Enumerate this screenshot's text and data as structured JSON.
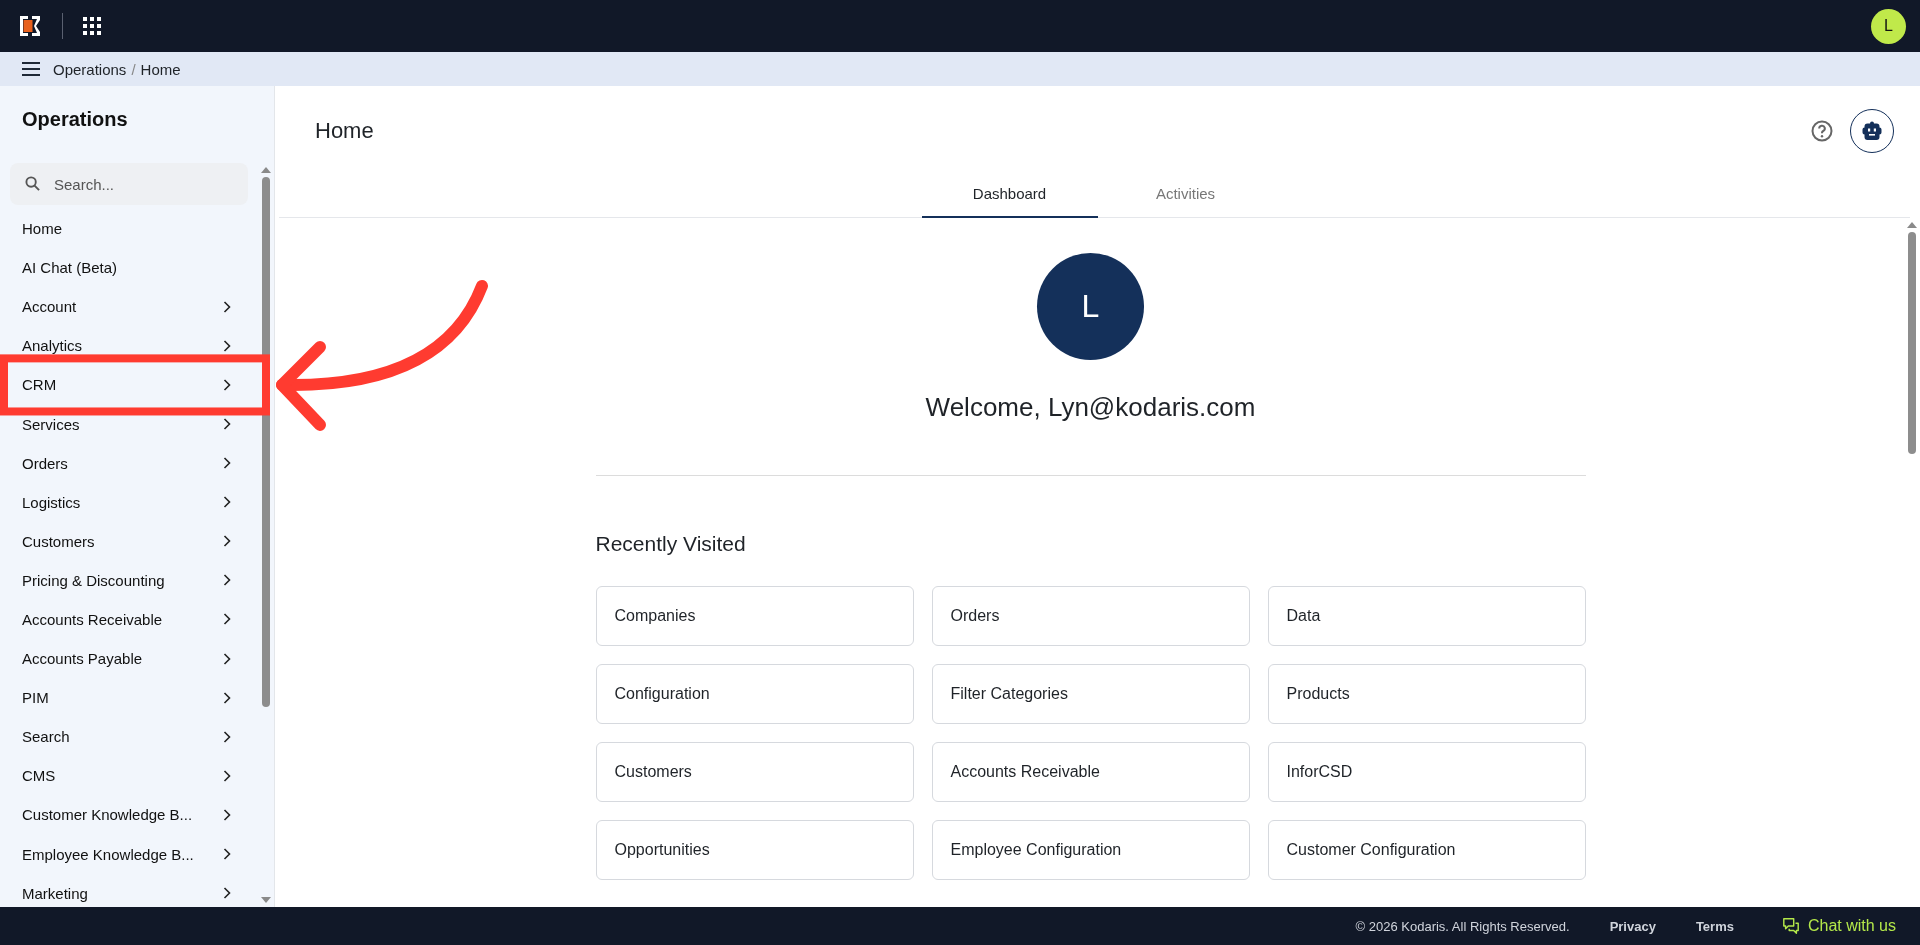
{
  "top_bar": {
    "avatar": "L"
  },
  "breadcrumb": {
    "separator": "/",
    "items": [
      {
        "label": "Operations"
      },
      {
        "label": "Home"
      }
    ]
  },
  "sidebar": {
    "title": "Operations",
    "search": {
      "placeholder": "Search..."
    },
    "items": [
      {
        "label": "Home",
        "has_children": false,
        "highlighted": false
      },
      {
        "label": "AI Chat (Beta)",
        "has_children": false,
        "highlighted": false
      },
      {
        "label": "Account",
        "has_children": true,
        "highlighted": false
      },
      {
        "label": "Analytics",
        "has_children": true,
        "highlighted": false
      },
      {
        "label": "CRM",
        "has_children": true,
        "highlighted": true
      },
      {
        "label": "Services",
        "has_children": true,
        "highlighted": false
      },
      {
        "label": "Orders",
        "has_children": true,
        "highlighted": false
      },
      {
        "label": "Logistics",
        "has_children": true,
        "highlighted": false
      },
      {
        "label": "Customers",
        "has_children": true,
        "highlighted": false
      },
      {
        "label": "Pricing & Discounting",
        "has_children": true,
        "highlighted": false
      },
      {
        "label": "Accounts Receivable",
        "has_children": true,
        "highlighted": false
      },
      {
        "label": "Accounts Payable",
        "has_children": true,
        "highlighted": false
      },
      {
        "label": "PIM",
        "has_children": true,
        "highlighted": false
      },
      {
        "label": "Search",
        "has_children": true,
        "highlighted": false
      },
      {
        "label": "CMS",
        "has_children": true,
        "highlighted": false
      },
      {
        "label": "Customer Knowledge B...",
        "has_children": true,
        "highlighted": false
      },
      {
        "label": "Employee Knowledge B...",
        "has_children": true,
        "highlighted": false
      },
      {
        "label": "Marketing",
        "has_children": true,
        "highlighted": false
      }
    ]
  },
  "page": {
    "title": "Home",
    "tabs": [
      {
        "label": "Dashboard",
        "selected": true
      },
      {
        "label": "Activities",
        "selected": false
      }
    ],
    "avatar": "L",
    "welcome": "Welcome, Lyn@kodaris.com",
    "recent_title": "Recently Visited",
    "recent": [
      "Companies",
      "Orders",
      "Data",
      "Configuration",
      "Filter Categories",
      "Products",
      "Customers",
      "Accounts Receivable",
      "InforCSD",
      "Opportunities",
      "Employee Configuration",
      "Customer Configuration"
    ]
  },
  "footer": {
    "copyright": "© 2026 Kodaris. All Rights Reserved.",
    "links": [
      "Privacy",
      "Terms"
    ],
    "chat": "Chat with us"
  }
}
